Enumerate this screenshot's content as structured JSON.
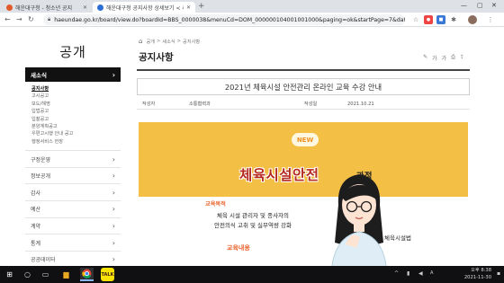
{
  "browser": {
    "tabs": [
      {
        "title": "해운대구청 - 청소년 공지"
      },
      {
        "title": "해운대구청 공지사항 상세보기 < 새소식 < 공개"
      }
    ],
    "address": "haeundae.go.kr/board/view.do?boardId=BBS_0000038&menuCd=DOM_000000104001001000&paging=ok&startPage=7&dataSid=30..."
  },
  "sidebar": {
    "title": "공개",
    "active_menu": "새소식",
    "submenu": [
      "공지사항",
      "고시공고",
      "보도/해명",
      "입법공고",
      "입찰공고",
      "분양계획공고",
      "우편고시행 안내 공고",
      "행정서비스 헌장"
    ],
    "menus": [
      "구정운영",
      "정보공개",
      "감사",
      "예산",
      "계약",
      "통계",
      "공공데이터"
    ]
  },
  "main": {
    "breadcrumb": [
      "공개",
      "새소식",
      "공지사항"
    ],
    "page_title": "공지사항",
    "tools": [
      "가",
      "가"
    ],
    "post_title": "2021년 체육시설 안전관리 온라인 교육 수강 안내",
    "meta": {
      "author_label": "작성자",
      "author": "소통협력과",
      "date_label": "작성일",
      "date": "2021.10.21"
    },
    "poster": {
      "badge": "NEW",
      "headline": "체육시설안전",
      "subheadline": "과정",
      "section1_label": "교육목적",
      "section1_text_line1": "체육 시설 관리자 및 종사자의",
      "section1_text_line2": "안전의식 고취 및 실무역량 강화",
      "section2_label": "교육내용",
      "section2_text": "체육시설법"
    }
  },
  "taskbar": {
    "time": "오후 8:38",
    "date": "2021-11-30"
  },
  "colors": {
    "poster_bg": "#f4bf45",
    "headline": "#b5291e",
    "accent": "#e8622b"
  }
}
